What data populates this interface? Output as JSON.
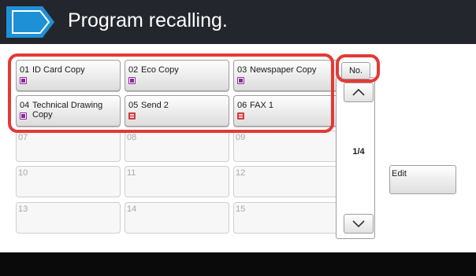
{
  "header": {
    "title": "Program recalling."
  },
  "programs": [
    {
      "num": "01",
      "name": "ID Card Copy",
      "icon": "copy-program-icon"
    },
    {
      "num": "02",
      "name": "Eco Copy",
      "icon": "copy-program-icon"
    },
    {
      "num": "03",
      "name": "Newspaper Copy",
      "icon": "copy-program-icon"
    },
    {
      "num": "04",
      "name": "Technical Drawing Copy",
      "icon": "copy-program-icon"
    },
    {
      "num": "05",
      "name": "Send 2",
      "icon": "send-program-icon"
    },
    {
      "num": "06",
      "name": "FAX 1",
      "icon": "fax-program-icon"
    },
    {
      "num": "07"
    },
    {
      "num": "08"
    },
    {
      "num": "09"
    },
    {
      "num": "10"
    },
    {
      "num": "11"
    },
    {
      "num": "12"
    },
    {
      "num": "13"
    },
    {
      "num": "14"
    },
    {
      "num": "15"
    }
  ],
  "controls": {
    "no_label": "No.",
    "page_indicator": "1/4",
    "edit_label": "Edit"
  },
  "colors": {
    "title_bar": "#24262e",
    "accent": "#1e90d6",
    "highlight": "#e53935",
    "copy_icon": "#8a2a98",
    "send_icon": "#d23c3c"
  }
}
